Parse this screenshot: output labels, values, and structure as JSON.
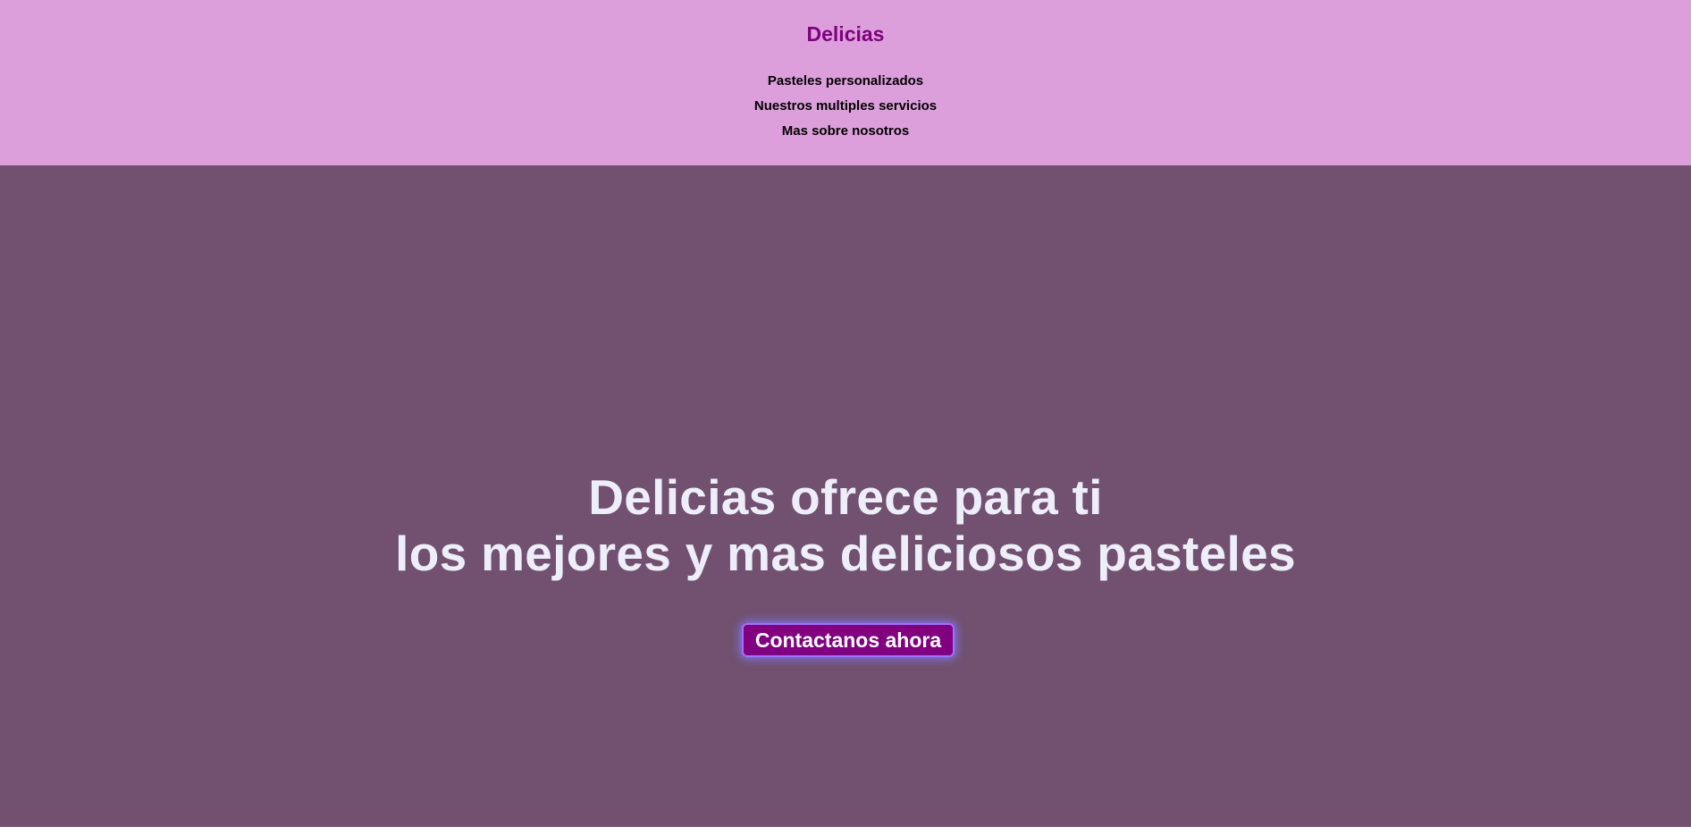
{
  "header": {
    "brand": "Delicias",
    "nav": [
      {
        "label": "Pasteles personalizados"
      },
      {
        "label": "Nuestros multiples servicios"
      },
      {
        "label": "Mas sobre nosotros"
      }
    ]
  },
  "hero": {
    "title_line1": "Delicias ofrece para ti",
    "title_line2": "los mejores y mas deliciosos pasteles",
    "cta_label": "Contactanos ahora"
  },
  "colors": {
    "header_bg": "#dd9fdc",
    "brand": "#800080",
    "hero_bg": "#71516f",
    "hero_text": "#eeeefb",
    "cta_bg": "#800080"
  }
}
